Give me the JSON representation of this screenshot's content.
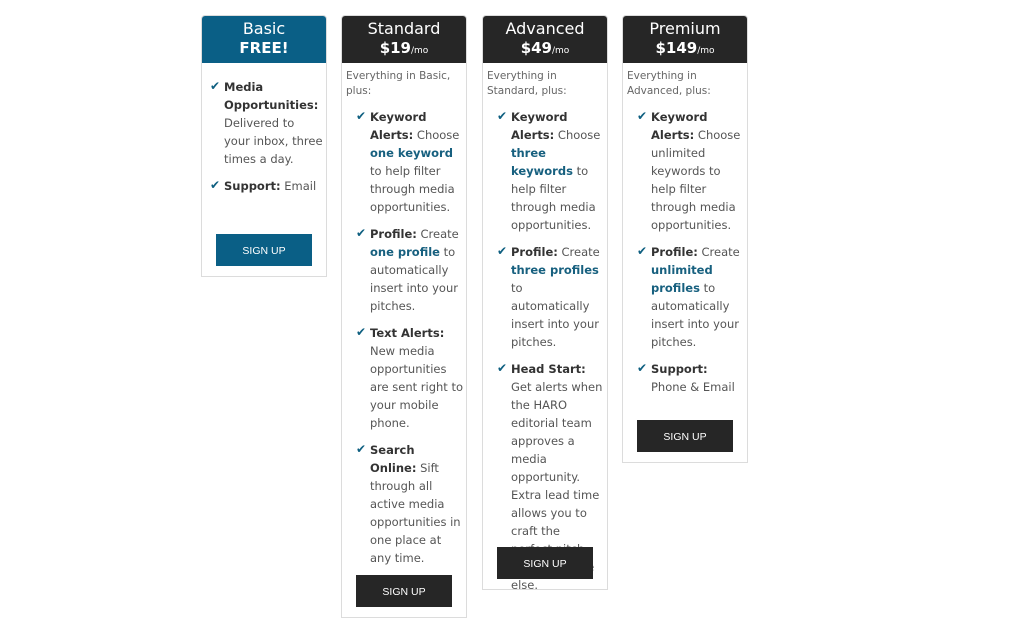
{
  "colors": {
    "basic": "#0a5f86",
    "dark": "#262626",
    "highlight": "#17607f"
  },
  "plans": [
    {
      "name": "Basic",
      "price": "FREE!",
      "per": "",
      "intro": "",
      "button": "SIGN UP",
      "theme": "basic",
      "features": [
        [
          {
            "t": "Media Opportunities:",
            "s": "lbl"
          },
          {
            "t": " Delivered to your inbox, three times a day."
          }
        ],
        [
          {
            "t": "Support:",
            "s": "lbl"
          },
          {
            "t": " Email"
          }
        ]
      ]
    },
    {
      "name": "Standard",
      "price": "$19",
      "per": "/mo",
      "intro": "Everything in Basic, plus:",
      "button": "SIGN UP",
      "theme": "dark",
      "features": [
        [
          {
            "t": "Keyword Alerts:",
            "s": "lbl"
          },
          {
            "t": " Choose "
          },
          {
            "t": "one keyword",
            "s": "hl"
          },
          {
            "t": " to help filter through media opportunities."
          }
        ],
        [
          {
            "t": "Profile:",
            "s": "lbl"
          },
          {
            "t": " Create "
          },
          {
            "t": "one profile",
            "s": "hl"
          },
          {
            "t": " to automatically insert into your pitches."
          }
        ],
        [
          {
            "t": "Text Alerts:",
            "s": "lbl"
          },
          {
            "t": " New media opportunities are sent right to your mobile phone."
          }
        ],
        [
          {
            "t": "Search Online:",
            "s": "lbl"
          },
          {
            "t": " Sift through all active media opportunities in one place at any time."
          }
        ]
      ]
    },
    {
      "name": "Advanced",
      "price": "$49",
      "per": "/mo",
      "intro": "Everything in Standard, plus:",
      "button": "SIGN UP",
      "theme": "dark",
      "features": [
        [
          {
            "t": "Keyword Alerts:",
            "s": "lbl"
          },
          {
            "t": " Choose "
          },
          {
            "t": "three keywords",
            "s": "hl"
          },
          {
            "t": " to help filter through media opportunities."
          }
        ],
        [
          {
            "t": "Profile:",
            "s": "lbl"
          },
          {
            "t": " Create "
          },
          {
            "t": "three profiles",
            "s": "hl"
          },
          {
            "t": " to automatically insert into your pitches."
          }
        ],
        [
          {
            "t": "Head Start:",
            "s": "lbl"
          },
          {
            "t": " Get alerts when the HARO editorial team approves a media opportunity. Extra lead time allows you to craft the perfect pitch before anyone else."
          }
        ]
      ]
    },
    {
      "name": "Premium",
      "price": "$149",
      "per": "/mo",
      "intro": "Everything in Advanced, plus:",
      "button": "SIGN UP",
      "theme": "dark",
      "features": [
        [
          {
            "t": "Keyword Alerts:",
            "s": "lbl"
          },
          {
            "t": " Choose unlimited keywords to help filter through media opportunities."
          }
        ],
        [
          {
            "t": "Profile:",
            "s": "lbl"
          },
          {
            "t": " Create "
          },
          {
            "t": "unlimited profiles",
            "s": "hl"
          },
          {
            "t": " to automatically insert into your pitches."
          }
        ],
        [
          {
            "t": "Support:",
            "s": "lbl"
          },
          {
            "t": " Phone & Email"
          }
        ]
      ]
    }
  ]
}
